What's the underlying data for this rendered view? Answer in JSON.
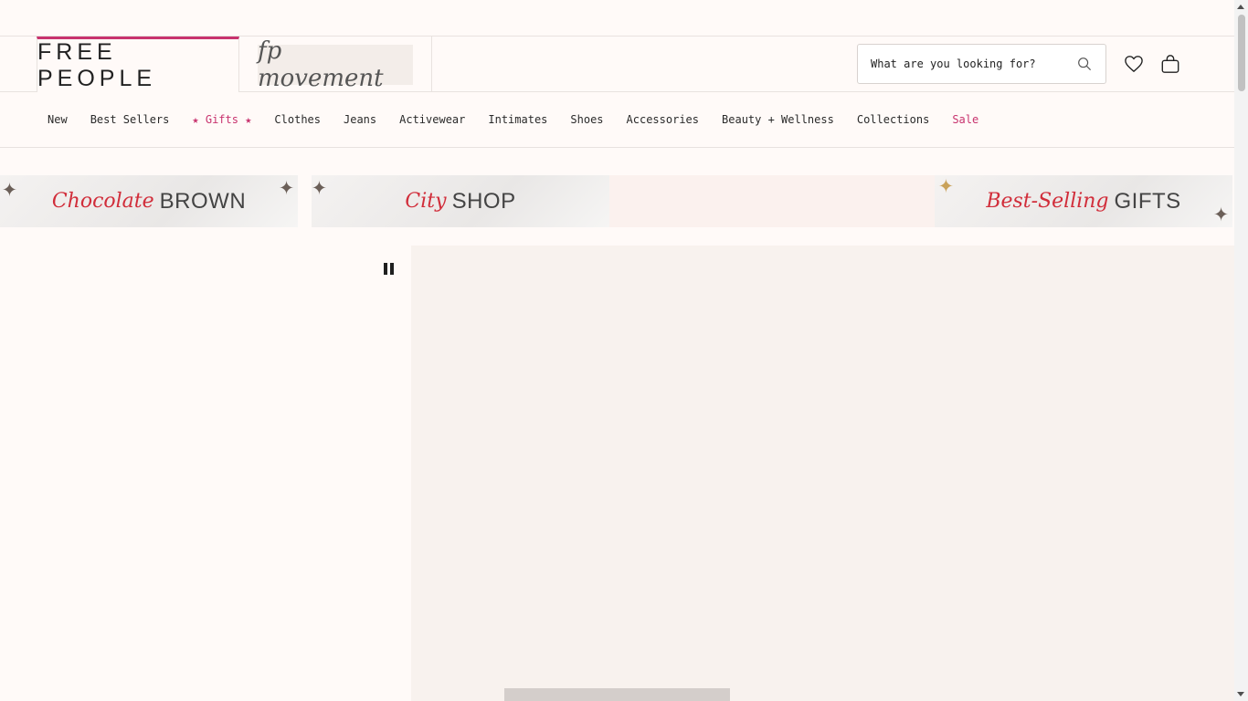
{
  "header": {
    "brand": "FREE PEOPLE",
    "secondary_brand": "fp movement",
    "search_placeholder": "What are you looking for?"
  },
  "nav": {
    "items": [
      {
        "label": "New"
      },
      {
        "label": "Best Sellers"
      },
      {
        "label": "★ Gifts ★"
      },
      {
        "label": "Clothes"
      },
      {
        "label": "Jeans"
      },
      {
        "label": "Activewear"
      },
      {
        "label": "Intimates"
      },
      {
        "label": "Shoes"
      },
      {
        "label": "Accessories"
      },
      {
        "label": "Beauty + Wellness"
      },
      {
        "label": "Collections"
      },
      {
        "label": "Sale"
      }
    ]
  },
  "promos": [
    {
      "script": "Chocolate",
      "caps": "BROWN"
    },
    {
      "script": "City",
      "caps": "SHOP"
    },
    {
      "script": "Best-Selling",
      "caps": "GIFTS"
    }
  ],
  "colors": {
    "accent": "#c8336e",
    "promo_script": "#d12d3a",
    "background": "#fffaf8",
    "hero_background": "#f8f2ee"
  },
  "icons": {
    "search": "search-icon",
    "wishlist": "heart-icon",
    "bag": "shopping-bag-icon",
    "pause": "pause-icon"
  }
}
